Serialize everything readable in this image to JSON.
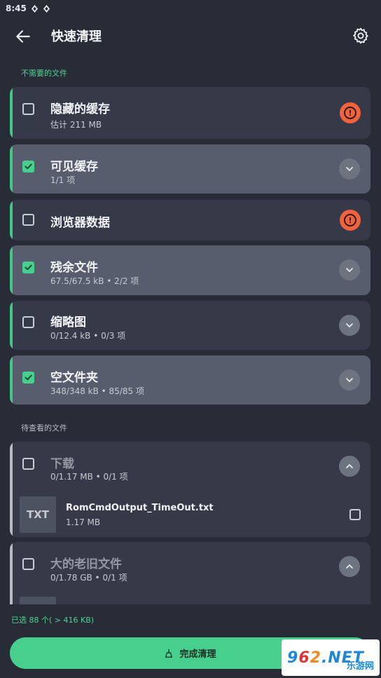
{
  "status_bar": {
    "time": "8:45"
  },
  "app_bar": {
    "title": "快速清理"
  },
  "sections": {
    "unneeded": "不需要的文件",
    "review": "待查看的文件"
  },
  "unneeded_items": [
    {
      "title": "隐藏的缓存",
      "subtitle": "估计 211 MB",
      "checked": false,
      "action": "warning-icon"
    },
    {
      "title": "可见缓存",
      "subtitle": "1/1 项",
      "checked": true,
      "action": "chevron-down-icon"
    },
    {
      "title": "浏览器数据",
      "subtitle": "",
      "checked": false,
      "action": "warning-icon"
    },
    {
      "title": "残余文件",
      "subtitle": "67.5/67.5 kB • 2/2 项",
      "checked": true,
      "action": "chevron-down-icon"
    },
    {
      "title": "缩略图",
      "subtitle": "0/12.4 kB • 0/3 项",
      "checked": false,
      "action": "chevron-down-icon"
    },
    {
      "title": "空文件夹",
      "subtitle": "348/348 kB • 85/85 项",
      "checked": true,
      "action": "chevron-down-icon"
    }
  ],
  "review_groups": [
    {
      "title": "下载",
      "subtitle": "0/1.17 MB • 0/1 项",
      "files": [
        {
          "thumb": "TXT",
          "name": "RomCmdOutput_TimeOut.txt",
          "size": "1.17 MB"
        }
      ]
    },
    {
      "title": "大的老旧文件",
      "subtitle": "0/1.78 GB • 0/1 项"
    }
  ],
  "summary": "已选 88 个( > 416 KB)",
  "finish_button": {
    "label": "完成清理"
  },
  "watermark": {
    "number_a": "9",
    "number_b": "6",
    "number_c": "2",
    "suffix": ".NET",
    "site": "乐游网"
  },
  "colors": {
    "accent": "#46cf8d",
    "warning": "#f2623c",
    "background": "#282c37",
    "card": "#363a48",
    "card_checked": "#575d6c"
  }
}
